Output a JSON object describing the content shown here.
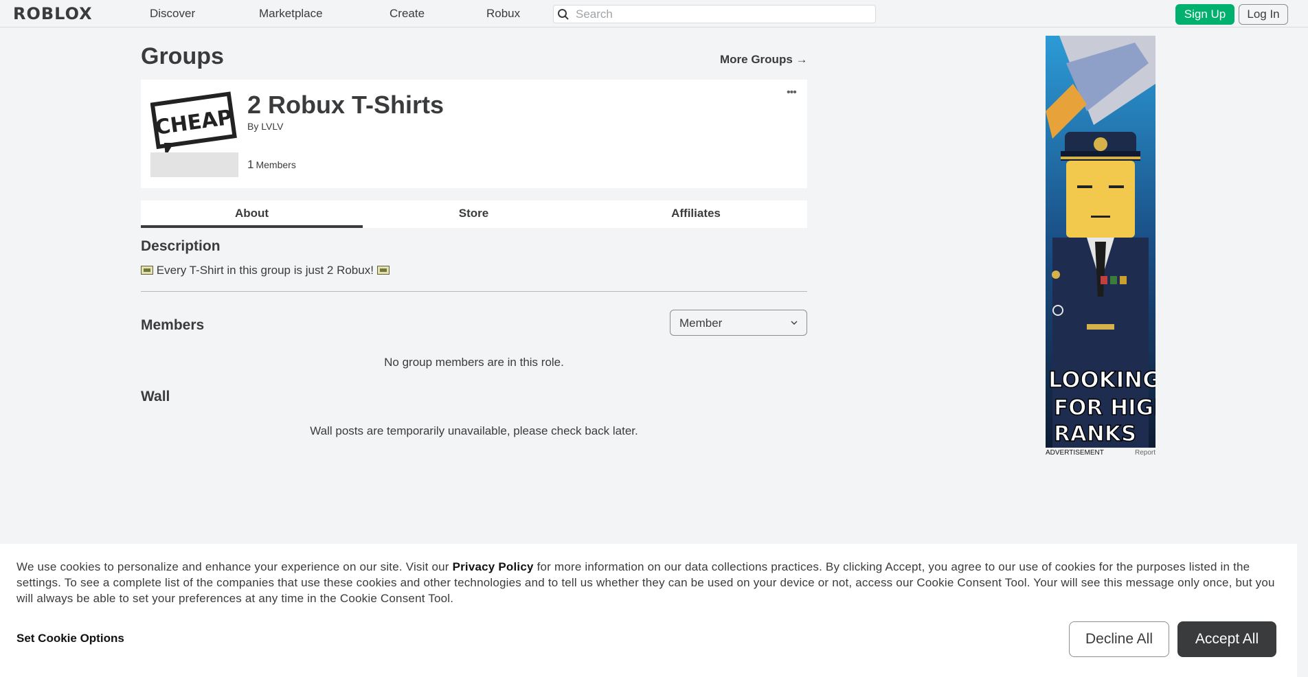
{
  "nav": {
    "logo": "ROBLOX",
    "links": [
      "Discover",
      "Marketplace",
      "Create",
      "Robux"
    ],
    "search_placeholder": "Search",
    "signup_label": "Sign Up",
    "login_label": "Log In"
  },
  "page": {
    "title": "Groups",
    "more_groups": "More Groups",
    "more_groups_arrow": "→"
  },
  "group": {
    "emblem_text": "CHEAP",
    "name": "2 Robux T-Shirts",
    "by_prefix": "By",
    "owner": "LVLV",
    "members_count": "1",
    "members_label": "Members",
    "more_menu": "•••"
  },
  "tabs": [
    "About",
    "Store",
    "Affiliates"
  ],
  "about": {
    "description_title": "Description",
    "description_text": "Every T-Shirt in this group is just 2 Robux!",
    "members_title": "Members",
    "role_selected": "Member",
    "members_empty": "No group members are in this role.",
    "wall_title": "Wall",
    "wall_empty": "Wall posts are temporarily unavailable, please check back later."
  },
  "ad": {
    "text_line1": "LOOKING",
    "text_line2": "FOR HIGH",
    "text_line3": "RANKS",
    "caption": "ADVERTISEMENT",
    "report": "Report"
  },
  "cookie": {
    "text_before": "We use cookies to personalize and enhance your experience on our site. Visit our ",
    "privacy_link": "Privacy Policy",
    "text_after": " for more information on our data collections practices. By clicking Accept, you agree to our use of cookies for the purposes listed in the settings. To see a complete list of the companies that use these cookies and other technologies and to tell us whether they can be used on your device or not, access our Cookie Consent Tool. Your will see this message only once, but you will always be able to set your preferences at any time in the Cookie Consent Tool.",
    "options_label": "Set Cookie Options",
    "decline_label": "Decline All",
    "accept_label": "Accept All"
  },
  "colors": {
    "signup_green": "#00b06f",
    "accept_dark": "#393b3d",
    "page_bg": "#f2f4f5"
  }
}
